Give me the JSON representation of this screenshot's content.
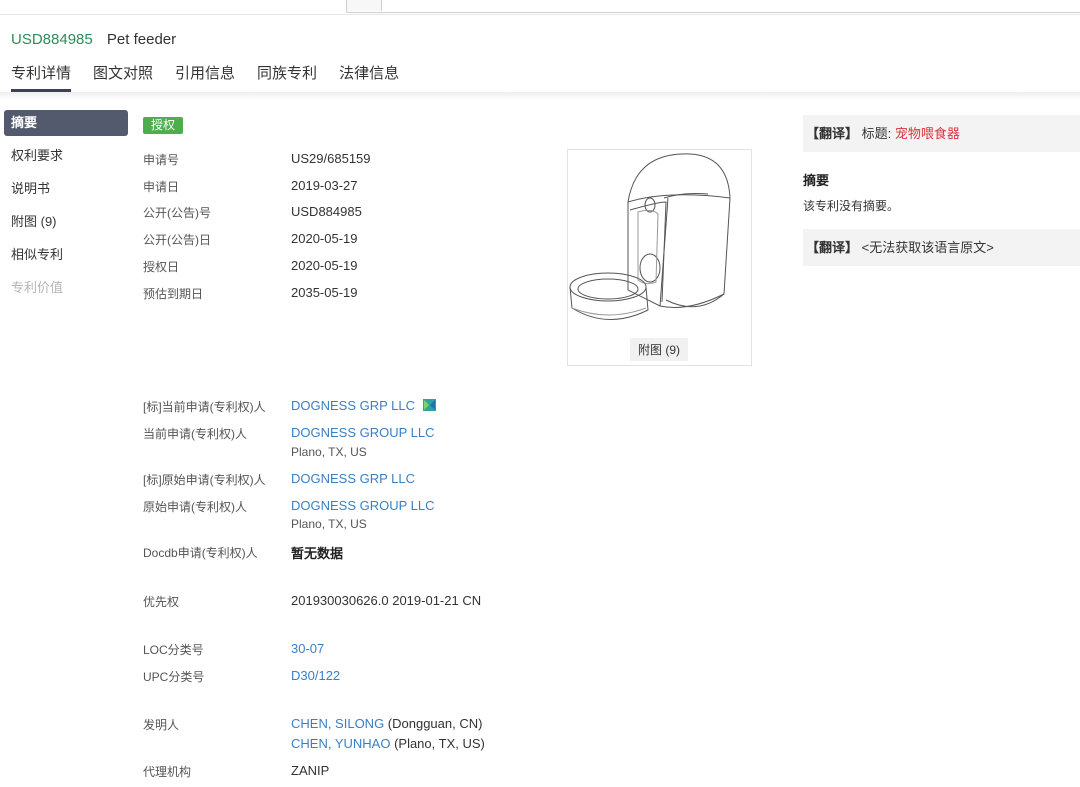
{
  "header": {
    "patent_number": "USD884985",
    "patent_name": "Pet feeder"
  },
  "tabs": [
    "专利详情",
    "图文对照",
    "引用信息",
    "同族专利",
    "法律信息"
  ],
  "sidebar": {
    "items": [
      {
        "label": "摘要"
      },
      {
        "label": "权利要求"
      },
      {
        "label": "说明书"
      },
      {
        "label": "附图 (9)"
      },
      {
        "label": "相似专利"
      },
      {
        "label": "专利价值"
      }
    ]
  },
  "status_badge": "授权",
  "details": {
    "application_no": {
      "label": "申请号",
      "value": "US29/685159"
    },
    "application_date": {
      "label": "申请日",
      "value": "2019-03-27"
    },
    "publication_no": {
      "label": "公开(公告)号",
      "value": "USD884985"
    },
    "publication_date": {
      "label": "公开(公告)日",
      "value": "2020-05-19"
    },
    "grant_date": {
      "label": "授权日",
      "value": "2020-05-19"
    },
    "expiry_date": {
      "label": "预估到期日",
      "value": "2035-05-19"
    },
    "std_current_applicant": {
      "label": "[标]当前申请(专利权)人",
      "value": "DOGNESS GRP LLC"
    },
    "current_applicant": {
      "label": "当前申请(专利权)人",
      "value": "DOGNESS GROUP LLC",
      "address": "Plano, TX, US"
    },
    "std_original_applicant": {
      "label": "[标]原始申请(专利权)人",
      "value": "DOGNESS GRP LLC"
    },
    "original_applicant": {
      "label": "原始申请(专利权)人",
      "value": "DOGNESS GROUP LLC",
      "address": "Plano, TX, US"
    },
    "docdb_applicant": {
      "label": "Docdb申请(专利权)人",
      "value": "暂无数据"
    },
    "priority": {
      "label": "优先权",
      "value": "201930030626.0 2019-01-21 CN"
    },
    "loc": {
      "label": "LOC分类号",
      "value": "30-07"
    },
    "upc": {
      "label": "UPC分类号",
      "value": "D30/122"
    },
    "inventors": {
      "label": "发明人",
      "list": [
        {
          "name": "CHEN, SILONG",
          "location": " (Dongguan, CN)"
        },
        {
          "name": "CHEN, YUNHAO",
          "location": " (Plano, TX, US)"
        }
      ]
    },
    "agency": {
      "label": "代理机构",
      "value": "ZANIP"
    }
  },
  "figure": {
    "caption": "附图 (9)"
  },
  "right_panel": {
    "translate_tag": "【翻译】",
    "title_prefix": "标题: ",
    "title_value": "宠物喂食器",
    "abstract_heading": "摘要",
    "abstract_text": "该专利没有摘要。",
    "translate_tag2": "【翻译】",
    "original_unavailable": "<无法获取该语言原文>"
  },
  "colors": {
    "patent_number": "#2e8b57",
    "link": "#3a7fc4",
    "badge": "#4cae4c",
    "nav_active": "#535a6e",
    "title_red": "#d9363e"
  }
}
